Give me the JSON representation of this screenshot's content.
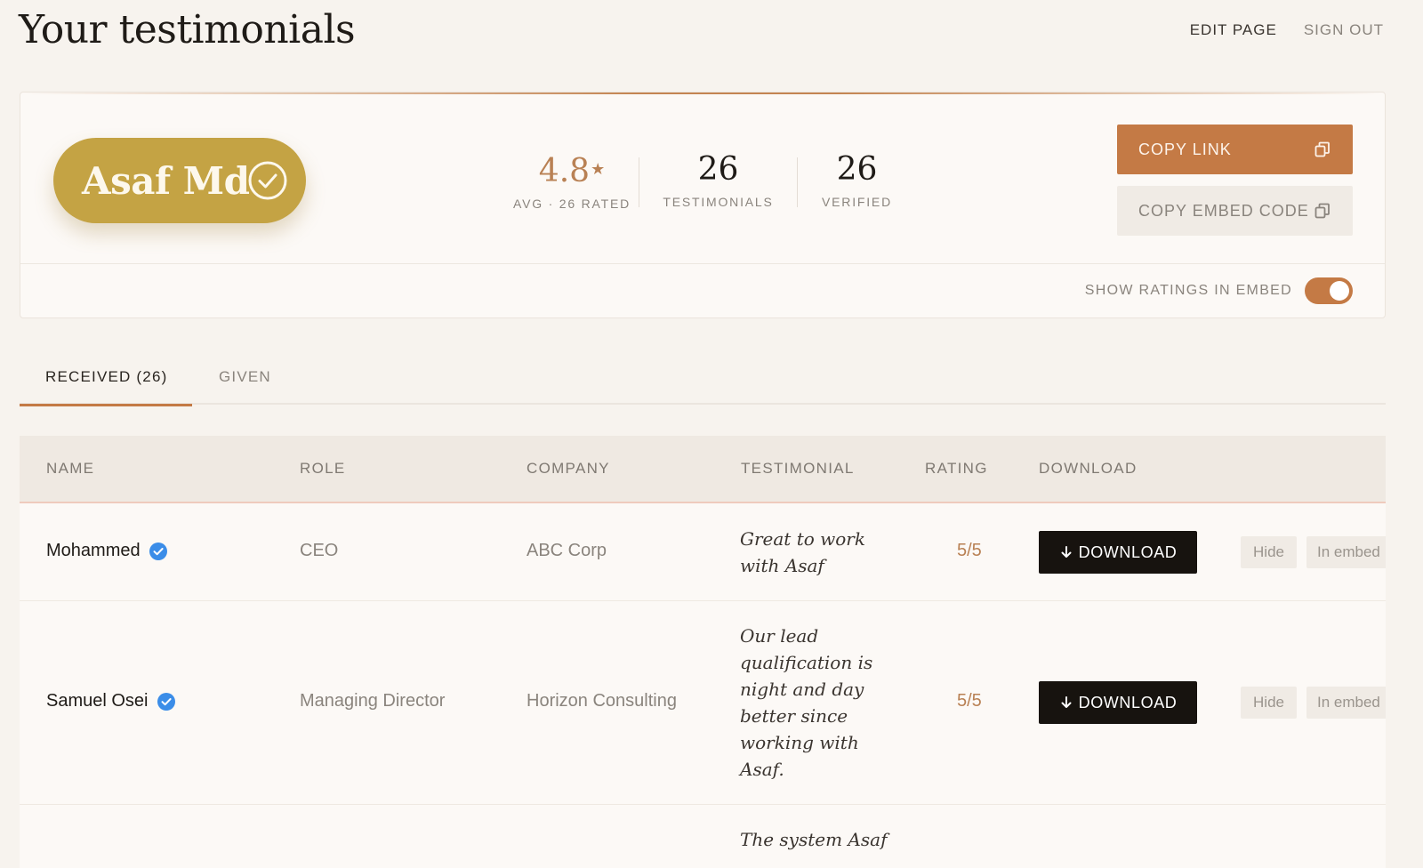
{
  "header": {
    "title": "Your testimonials",
    "nav": {
      "edit_page": "EDIT PAGE",
      "sign_out": "SIGN OUT"
    }
  },
  "profile": {
    "name": "Asaf Md",
    "badge_color": "#c4a344",
    "stats": {
      "avg_rating": "4.8",
      "avg_star": "★",
      "avg_label": "AVG · 26 RATED",
      "testimonials": "26",
      "testimonials_label": "TESTIMONIALS",
      "verified": "26",
      "verified_label": "VERIFIED"
    },
    "buttons": {
      "copy_link": "COPY LINK",
      "copy_embed": "COPY EMBED CODE"
    },
    "toggle": {
      "label": "SHOW RATINGS IN EMBED",
      "on": true
    }
  },
  "tabs": [
    {
      "label": "RECEIVED (26)",
      "active": true
    },
    {
      "label": "GIVEN",
      "active": false
    }
  ],
  "table": {
    "columns": [
      "NAME",
      "ROLE",
      "COMPANY",
      "TESTIMONIAL",
      "RATING",
      "DOWNLOAD"
    ],
    "rows": [
      {
        "name": "Mohammed",
        "verified": true,
        "role": "CEO",
        "company": "ABC Corp",
        "testimonial_lines": [
          "Great to work",
          "with Asaf"
        ],
        "rating": "5/5",
        "download": "DOWNLOAD",
        "hide": "Hide",
        "embed": "In embed"
      },
      {
        "name": "Samuel Osei",
        "verified": true,
        "role": "Managing Director",
        "company": "Horizon Consulting",
        "testimonial_lines": [
          "Our lead",
          "qualification is",
          "night and day",
          "better since",
          "working with",
          "Asaf."
        ],
        "rating": "5/5",
        "download": "DOWNLOAD",
        "hide": "Hide",
        "embed": "In embed"
      },
      {
        "testimonial_lines": [
          "The system Asaf"
        ]
      }
    ]
  },
  "colors": {
    "accent": "#c47a45",
    "gold": "#c4a344",
    "background": "#f7f3ee",
    "verified_blue": "#3b8de8"
  },
  "icons": [
    "circle-check-icon",
    "copy-icon",
    "verified-check-icon",
    "arrow-down-icon"
  ]
}
